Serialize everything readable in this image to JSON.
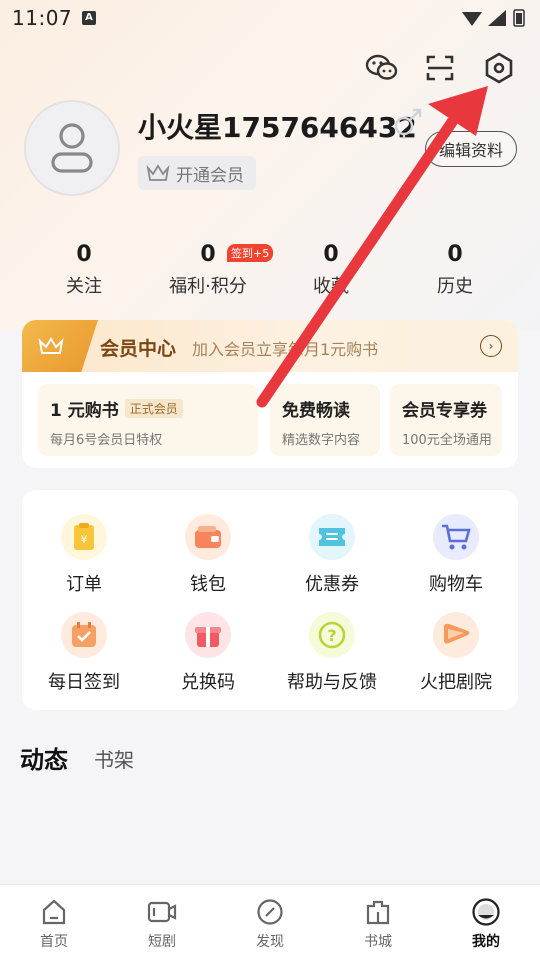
{
  "status_bar": {
    "time": "11:07",
    "indicator": "A"
  },
  "header": {
    "icons": [
      "wechat-icon",
      "scan-icon",
      "settings-icon"
    ]
  },
  "profile": {
    "username": "小火星1757646432",
    "vip_label": "开通会员",
    "edit_label": "编辑资料"
  },
  "stats": [
    {
      "value": "0",
      "label": "关注"
    },
    {
      "value": "0",
      "label": "福利·积分"
    },
    {
      "value": "0",
      "label": "收藏"
    },
    {
      "value": "0",
      "label": "历史"
    }
  ],
  "stats_badge": "签到+5",
  "vip_center": {
    "title": "会员中心",
    "subtitle": "加入会员立享每月1元购书",
    "tiles": [
      {
        "title": "1 元购书",
        "tag": "正式会员",
        "desc": "每月6号会员日特权"
      },
      {
        "title": "免费畅读",
        "desc": "精选数字内容"
      },
      {
        "title": "会员专享券",
        "desc": "100元全场通用"
      }
    ]
  },
  "menu": [
    {
      "label": "订单",
      "icon": "order-icon"
    },
    {
      "label": "钱包",
      "icon": "wallet-icon"
    },
    {
      "label": "优惠券",
      "icon": "coupon-icon"
    },
    {
      "label": "购物车",
      "icon": "cart-icon"
    },
    {
      "label": "每日签到",
      "icon": "calendar-check-icon"
    },
    {
      "label": "兑换码",
      "icon": "gift-icon"
    },
    {
      "label": "帮助与反馈",
      "icon": "help-icon"
    },
    {
      "label": "火把剧院",
      "icon": "theater-icon"
    }
  ],
  "content_tabs": {
    "active": "动态",
    "inactive": "书架"
  },
  "bottom_nav": [
    {
      "label": "首页",
      "icon": "home-icon"
    },
    {
      "label": "短剧",
      "icon": "video-icon"
    },
    {
      "label": "发现",
      "icon": "compass-icon"
    },
    {
      "label": "书城",
      "icon": "bookstore-icon"
    },
    {
      "label": "我的",
      "icon": "profile-icon",
      "active": true
    }
  ],
  "colors": {
    "accent_red": "#e8383d",
    "vip_gold": "#e8982c",
    "vip_brown": "#7a4712"
  }
}
